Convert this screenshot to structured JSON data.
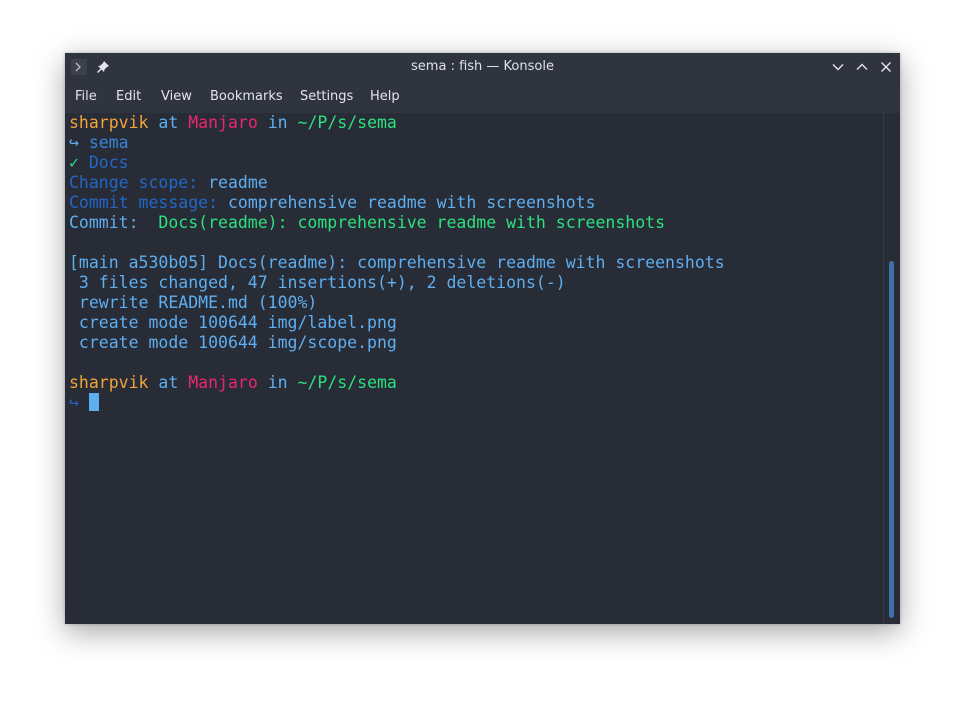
{
  "window": {
    "title": "sema : fish — Konsole"
  },
  "menubar": {
    "items": [
      "File",
      "Edit",
      "View",
      "Bookmarks",
      "Settings",
      "Help"
    ]
  },
  "terminal": {
    "prompt1": {
      "user": "sharpvik",
      "at": " at ",
      "host": "Manjaro",
      "in": " in ",
      "path": "~/P/s/sema"
    },
    "cmd_arrow": "↪ ",
    "cmd": "sema",
    "check": "✓ ",
    "commit_type": "Docs",
    "scope_label": "Change scope: ",
    "scope_value": "readme",
    "message_label": "Commit message: ",
    "message_value": "comprehensive readme with screenshots",
    "commit_label": "Commit:  ",
    "commit_value": "Docs(readme): comprehensive readme with screenshots",
    "out1": "[main a530b05] Docs(readme): comprehensive readme with screenshots",
    "out2": " 3 files changed, 47 insertions(+), 2 deletions(-)",
    "out3": " rewrite README.md (100%)",
    "out4": " create mode 100644 img/label.png",
    "out5": " create mode 100644 img/scope.png",
    "prompt2": {
      "user": "sharpvik",
      "at": " at ",
      "host": "Manjaro",
      "in": " in ",
      "path": "~/P/s/sema"
    },
    "input_arrow": "↪ "
  },
  "colors": {
    "user": "#f3a33a",
    "host": "#e8276f",
    "path": "#2ce17e",
    "text": "#5eaef0",
    "dim": "#2367c6",
    "background": "#282c36"
  },
  "icons": [
    "terminal-app-icon",
    "pin-icon",
    "minimize-icon",
    "maximize-icon",
    "close-icon"
  ]
}
